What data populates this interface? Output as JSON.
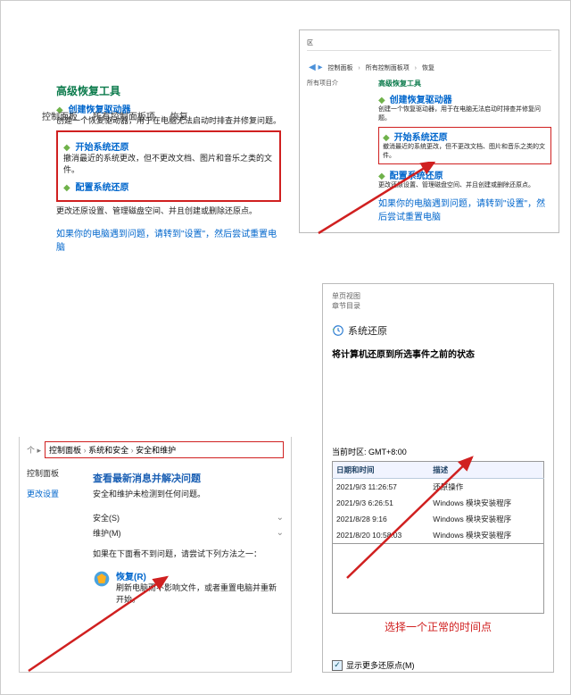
{
  "tl": {
    "breadcrumb": {
      "a": "控制面板",
      "b": "所有控制面板项",
      "c": "恢复"
    },
    "title": "高级恢复工具",
    "item1": {
      "link": "创建恢复驱动器",
      "desc": "创建一个恢复驱动器，用于在电脑无法启动时排查并修复问题。"
    },
    "item2": {
      "link": "开始系统还原",
      "desc": "撤消最近的系统更改，但不更改文档、图片和音乐之类的文件。"
    },
    "item3": {
      "link": "配置系统还原",
      "desc": "更改还原设置、管理磁盘空间、并且创建或删除还原点。"
    },
    "footer": "如果你的电脑遇到问题，请转到\"设置\"，然后尝试重置电脑"
  },
  "tr": {
    "tab": "区",
    "bc": {
      "a": "控制面板",
      "b": "所有控制面板项",
      "c": "恢复"
    },
    "side": "所有项目介",
    "title": "高级恢复工具",
    "item1": {
      "link": "创建恢复驱动器",
      "desc": "创建一个恢复驱动器，用于在电脑无法启动时排查并修复问题。"
    },
    "item2": {
      "link": "开始系统还原",
      "desc": "撤消最近的系统更改，但不更改文档、图片和音乐之类的文件。"
    },
    "item3": {
      "link": "配置系统还原",
      "desc": "更改还原设置、管理磁盘空间、并且创建或删除还原点。"
    },
    "footer": "如果你的电脑遇到问题，请转到\"设置\"，然后尝试重置电脑"
  },
  "bl": {
    "bc": {
      "a": "控制面板",
      "b": "系统和安全",
      "c": "安全和维护"
    },
    "sidebar": {
      "cp": "控制面板",
      "setting": "更改设置"
    },
    "heading": "查看最新消息并解决问题",
    "sub": "安全和维护未检测到任何问题。",
    "sec": "安全(S)",
    "mnt": "维护(M)",
    "q": "如果在下面看不到问题，请尝试下列方法之一：",
    "restore": {
      "link": "恢复(R)",
      "desc": "刷新电脑而不影响文件，或者重置电脑并重新开始。"
    }
  },
  "br": {
    "top1": "单页视图",
    "top2": "章节目录",
    "title": "系统还原",
    "subtitle": "将计算机还原到所选事件之前的状态",
    "tz": "当前时区: GMT+8:00",
    "cols": {
      "date": "日期和时间",
      "desc": "描述"
    },
    "rows": [
      {
        "date": "2021/9/3 11:26:57",
        "desc": "还原操作"
      },
      {
        "date": "2021/9/3 6:26:51",
        "desc": "Windows 模块安装程序"
      },
      {
        "date": "2021/8/28 9:16",
        "desc": "Windows 模块安装程序"
      },
      {
        "date": "2021/8/20 10:58:03",
        "desc": "Windows 模块安装程序"
      }
    ],
    "note": "选择一个正常的时间点",
    "checkbox": "显示更多还原点(M)"
  }
}
